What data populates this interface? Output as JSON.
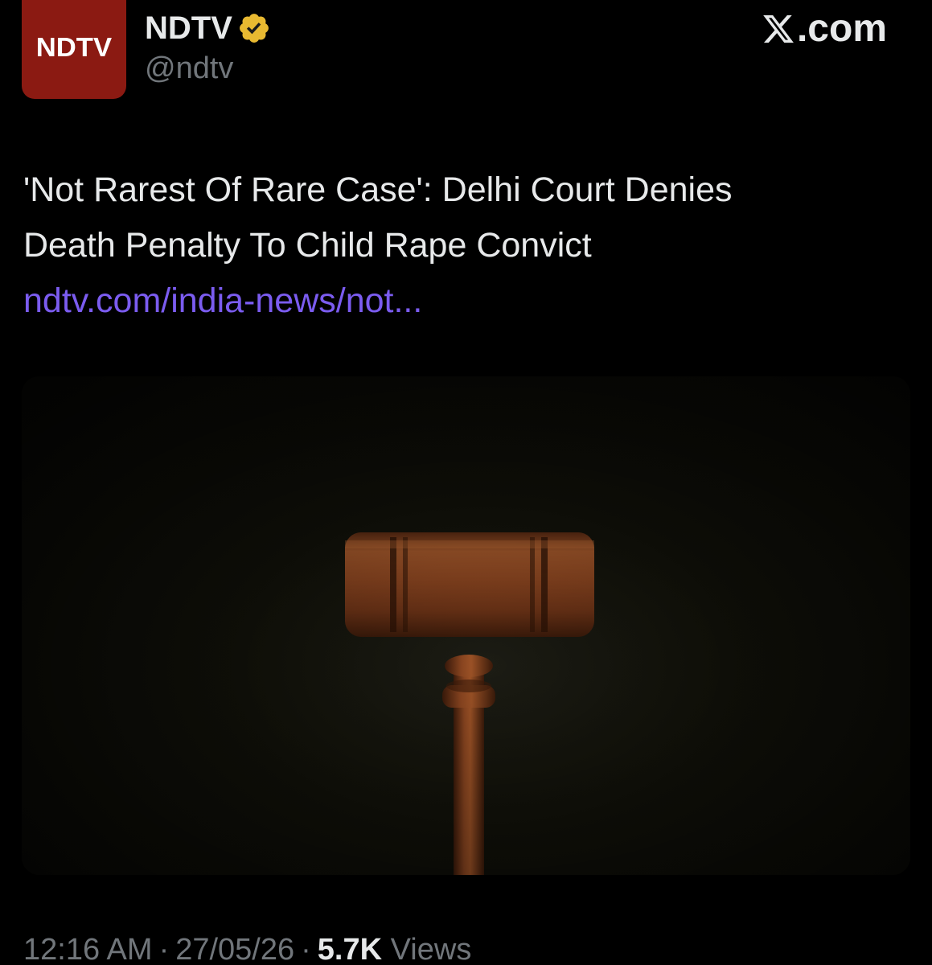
{
  "account": {
    "avatar_logo_text": "NDTV",
    "display_name": "NDTV",
    "handle": "@ndtv",
    "verified_color": "#e8b931",
    "avatar_color": "#8b1a12"
  },
  "brand": {
    "icon": "x-logo-icon",
    "text": ".com"
  },
  "tweet": {
    "line1": "'Not Rarest Of Rare Case': Delhi Court Denies",
    "line2": "Death Penalty To Child Rape Convict",
    "link": "ndtv.com/india-news/not...",
    "link_color": "#7b5cf0"
  },
  "media": {
    "subject": "wooden-gavel-image"
  },
  "meta": {
    "time": "12:16 AM",
    "date": "27/05/26",
    "views_count": "5.7K",
    "views_label": "Views",
    "separator": "·"
  }
}
